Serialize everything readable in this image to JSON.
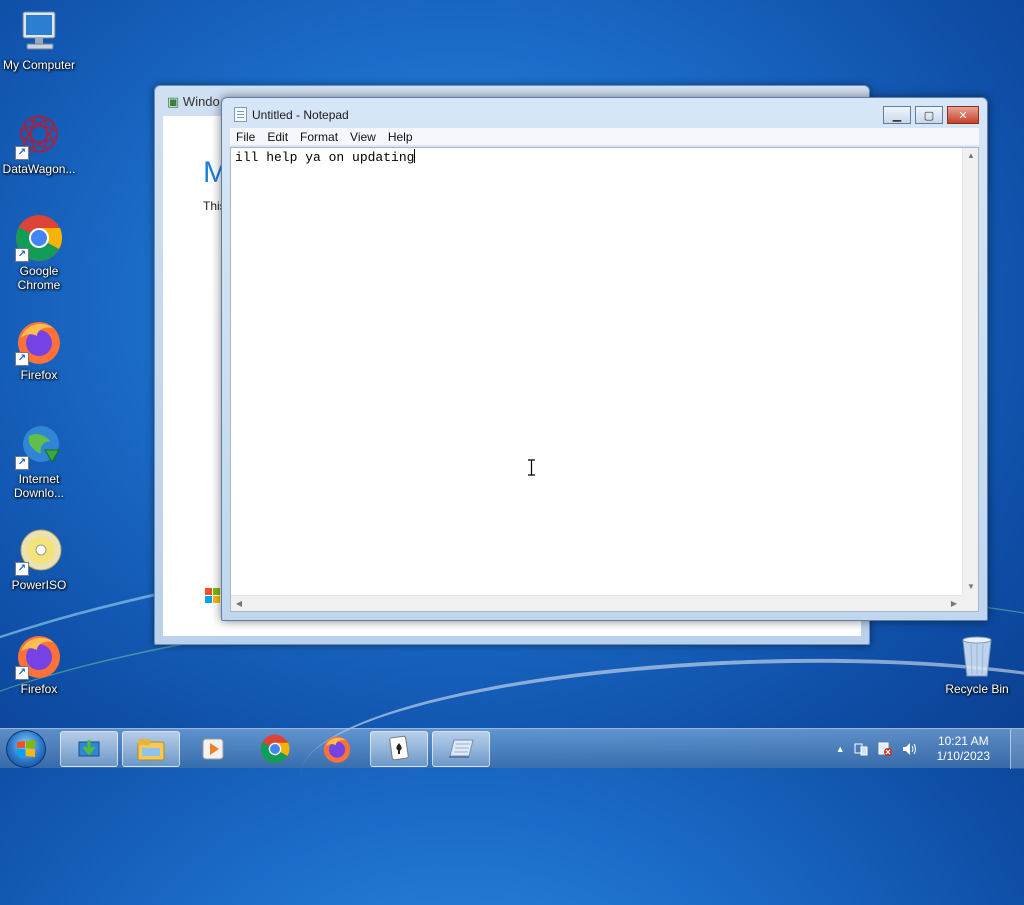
{
  "desktop_icons": [
    {
      "label": "My Computer",
      "icon": "my-computer-icon"
    },
    {
      "label": "DataWagon...",
      "icon": "datawagon-icon"
    },
    {
      "label": "Google Chrome",
      "icon": "chrome-icon"
    },
    {
      "label": "Firefox",
      "icon": "firefox-icon"
    },
    {
      "label": "Internet Downlo...",
      "icon": "internet-download-manager-icon"
    },
    {
      "label": "PowerISO",
      "icon": "poweriso-icon"
    },
    {
      "label": "Firefox",
      "icon": "firefox-icon"
    }
  ],
  "recycle_bin": {
    "label": "Recycle Bin",
    "icon": "recycle-bin-icon"
  },
  "background_window": {
    "title": "Windo",
    "heading": "M",
    "text": "This"
  },
  "notepad": {
    "title": "Untitled - Notepad",
    "menu": [
      "File",
      "Edit",
      "Format",
      "View",
      "Help"
    ],
    "content": "ill help ya on updating"
  },
  "taskbar": {
    "items": [
      "start-orb",
      "idm-taskbar-icon",
      "explorer-taskbar-icon",
      "media-player-taskbar-icon",
      "chrome-taskbar-icon",
      "firefox-taskbar-icon",
      "solitaire-taskbar-icon",
      "notepad-taskbar-icon"
    ],
    "clock_time": "10:21 AM",
    "clock_date": "1/10/2023"
  },
  "colors": {
    "desktop": "#1b6cc8",
    "accent_title": "#1f7fd6",
    "close_button": "#c5412a"
  }
}
